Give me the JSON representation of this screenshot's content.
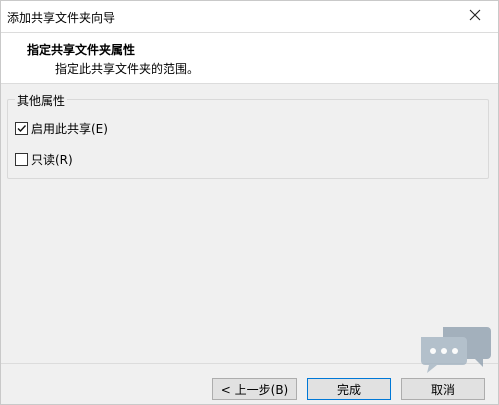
{
  "window": {
    "title": "添加共享文件夹向导",
    "close_icon": "close-icon"
  },
  "header": {
    "title": "指定共享文件夹属性",
    "description": "指定此共享文件夹的范围。"
  },
  "group": {
    "legend": "其他属性",
    "options": [
      {
        "label": "启用此共享(E)",
        "checked": true
      },
      {
        "label": "只读(R)",
        "checked": false
      }
    ]
  },
  "buttons": {
    "back": "< 上一步(B)",
    "finish": "完成",
    "cancel": "取消"
  },
  "colors": {
    "accent": "#0078d7",
    "dialog_bg": "#f0f0f0"
  }
}
